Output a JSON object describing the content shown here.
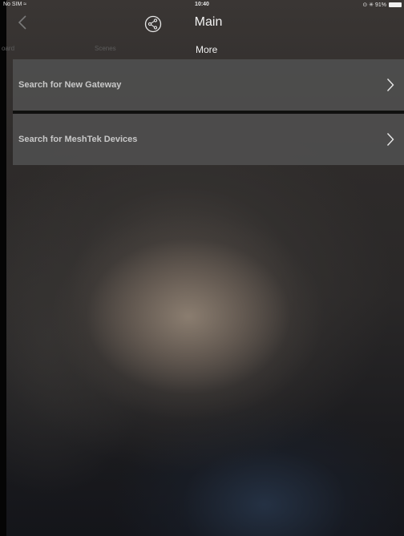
{
  "status_bar": {
    "carrier": "No SIM",
    "wifi_icon": "wifi-icon",
    "time": "10:40",
    "right": "⊙ ✳ 91%",
    "battery_icon": "battery-icon"
  },
  "nav": {
    "back_icon": "chevron-left-icon",
    "share_icon": "share-icon",
    "title": "Main"
  },
  "tabs": [
    {
      "label": "oard",
      "selected": false
    },
    {
      "label": "Scenes",
      "selected": false
    },
    {
      "label": "More",
      "selected": true
    }
  ],
  "list": {
    "items": [
      {
        "label": "Search for New Gateway",
        "icon": "chevron-right-icon"
      },
      {
        "label": "Search for MeshTek Devices",
        "icon": "chevron-right-icon"
      }
    ]
  },
  "colors": {
    "row_background": "#505050",
    "row_text": "#c8c8c8",
    "title_text": "#f2f2f2",
    "inactive_tab": "#5c5c5c"
  }
}
